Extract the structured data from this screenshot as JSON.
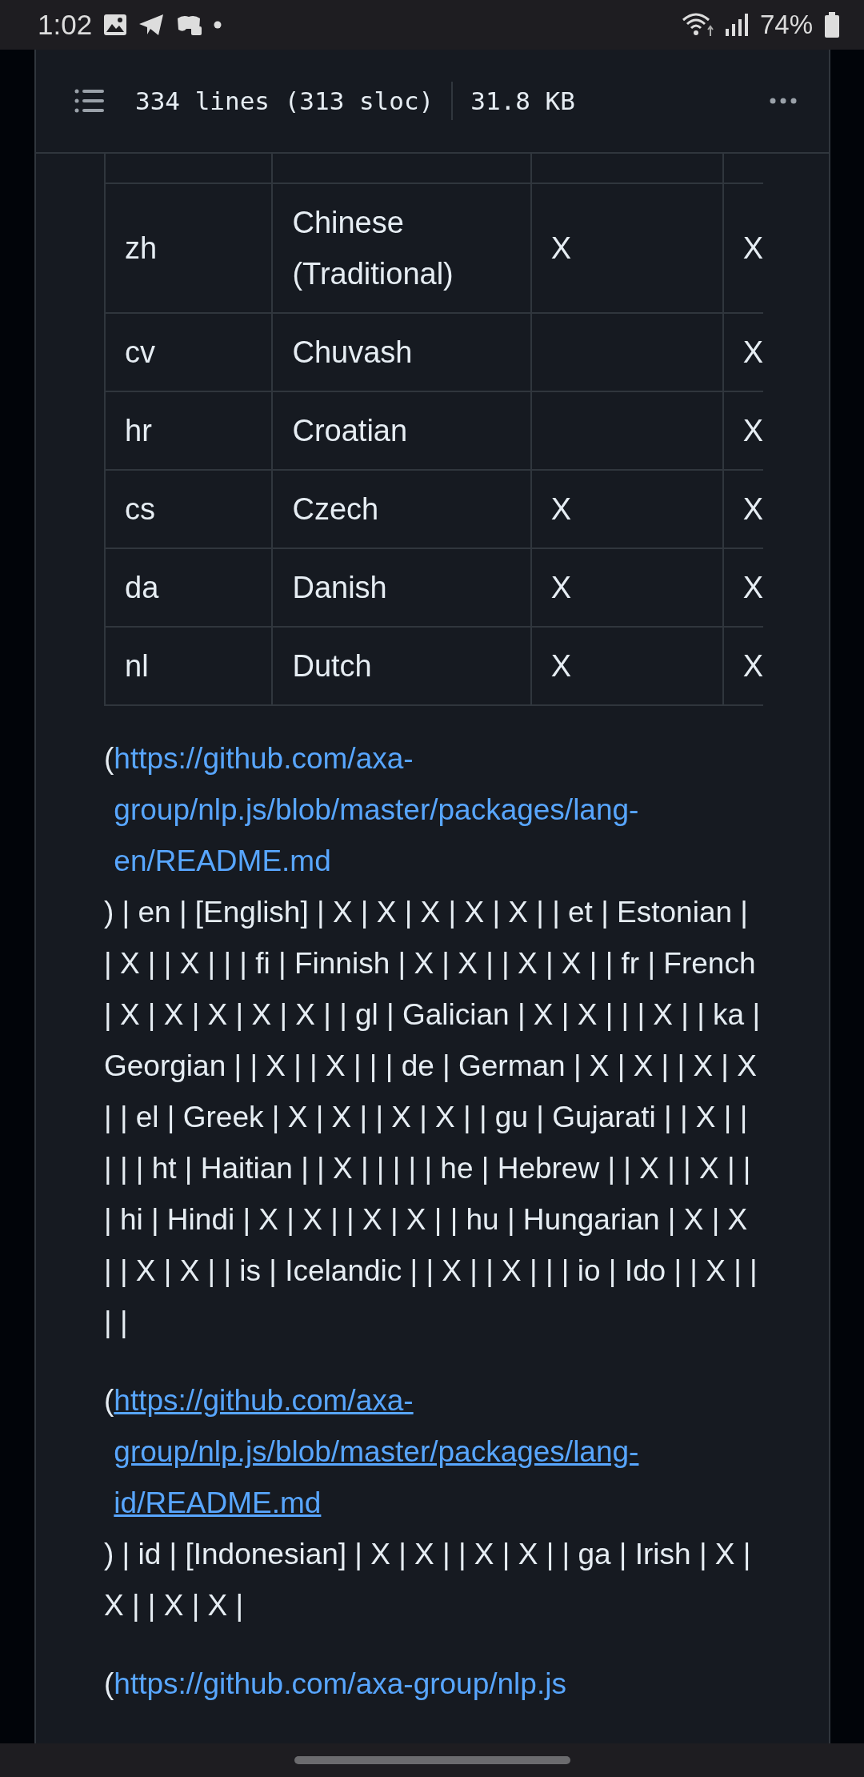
{
  "status_bar": {
    "time": "1:02",
    "battery": "74%"
  },
  "file_header": {
    "lines": "334 lines (313 sloc)",
    "size": "31.8 KB"
  },
  "table": {
    "rows": [
      {},
      {
        "code": "zh",
        "name": "Chinese (Traditional)",
        "column_3": "X",
        "column_4": "X"
      },
      {
        "code": "cv",
        "name": "Chuvash",
        "column_4": "X"
      },
      {
        "code": "hr",
        "name": "Croatian",
        "column_4": "X"
      },
      {
        "code": "cs",
        "name": "Czech",
        "column_3": "X",
        "column_4": "X"
      },
      {
        "code": "da",
        "name": "Danish",
        "column_3": "X",
        "column_4": "X"
      },
      {
        "code": "nl",
        "name": "Dutch",
        "column_3": "X",
        "column_4": "X"
      }
    ]
  },
  "paragraphs": [
    {
      "before": "(",
      "link": {
        "text": "https://github.com/axa-group/nlp.js/blob/master/packages/lang-en/README.md",
        "underlined": false
      },
      "after": ") | en | [English] | X | X | X | X | X | | et | Estonian | | X | | X | | | fi | Finnish | X | X | | X | X | | fr | French | X | X | X | X | X | | gl | Galician | X | X | | | X | | ka | Georgian | | X | | X | | | de | German | X | X | | X | X | | el | Greek | X | X | | X | X | | gu | Gujarati | | X | | | | | ht | Haitian | | X | | | | | he | Hebrew | | X | | X | | | hi | Hindi | X | X | | X | X | | hu | Hungarian | X | X | | X | X | | is | Icelandic | | X | | X | | | io | Ido | | X | | | |"
    },
    {
      "before": "(",
      "link": {
        "text": "https://github.com/axa-group/nlp.js/blob/master/packages/lang-id/README.md",
        "underlined": true
      },
      "after": ") | id | [Indonesian] | X | X | | X | X | | ga | Irish | X | X | | X | X |"
    },
    {
      "before": "(",
      "link": {
        "text": "https://github.com/axa-group/nlp.js",
        "underlined": false
      }
    }
  ]
}
